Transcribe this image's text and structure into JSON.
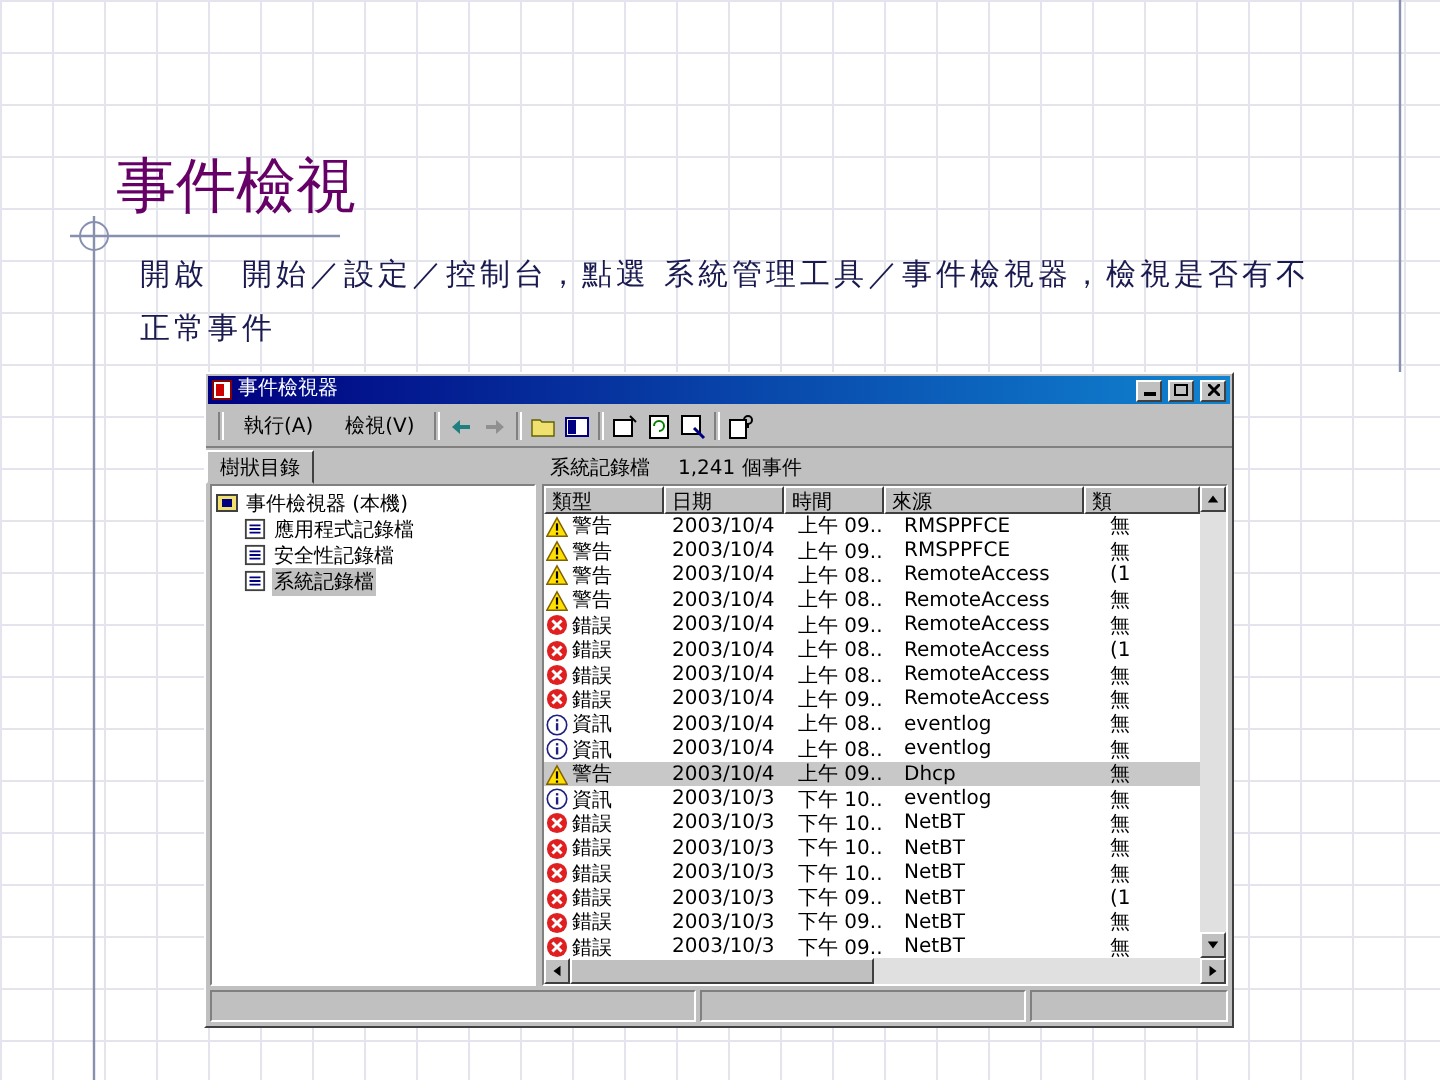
{
  "slide": {
    "title": "事件檢視",
    "body": "開啟　開始／設定／控制台，點選 系統管理工具／事件檢視器，檢視是否有不正常事件"
  },
  "window": {
    "title": "事件檢視器"
  },
  "menu": [
    "執行(A)",
    "檢視(V)"
  ],
  "tree_tab": "樹狀目錄",
  "list_header": {
    "name": "系統記錄檔",
    "count": "1,241 個事件"
  },
  "tree": {
    "label": "事件檢視器 (本機)",
    "children": [
      {
        "label": "應用程式記錄檔",
        "selected": false
      },
      {
        "label": "安全性記錄檔",
        "selected": false
      },
      {
        "label": "系統記錄檔",
        "selected": true
      }
    ]
  },
  "table": {
    "columns": [
      "類型",
      "日期",
      "時間",
      "來源",
      "類"
    ],
    "rows": [
      {
        "kind": "warning",
        "type": "警告",
        "date": "2003/10/4",
        "time": "上午 09..",
        "source": "RMSPPFCE",
        "category": "無",
        "selected": false
      },
      {
        "kind": "warning",
        "type": "警告",
        "date": "2003/10/4",
        "time": "上午 09..",
        "source": "RMSPPFCE",
        "category": "無",
        "selected": false
      },
      {
        "kind": "warning",
        "type": "警告",
        "date": "2003/10/4",
        "time": "上午 08..",
        "source": "RemoteAccess",
        "category": "(1",
        "selected": false
      },
      {
        "kind": "warning",
        "type": "警告",
        "date": "2003/10/4",
        "time": "上午 08..",
        "source": "RemoteAccess",
        "category": "無",
        "selected": false
      },
      {
        "kind": "error",
        "type": "錯誤",
        "date": "2003/10/4",
        "time": "上午 09..",
        "source": "RemoteAccess",
        "category": "無",
        "selected": false
      },
      {
        "kind": "error",
        "type": "錯誤",
        "date": "2003/10/4",
        "time": "上午 08..",
        "source": "RemoteAccess",
        "category": "(1",
        "selected": false
      },
      {
        "kind": "error",
        "type": "錯誤",
        "date": "2003/10/4",
        "time": "上午 08..",
        "source": "RemoteAccess",
        "category": "無",
        "selected": false
      },
      {
        "kind": "error",
        "type": "錯誤",
        "date": "2003/10/4",
        "time": "上午 09..",
        "source": "RemoteAccess",
        "category": "無",
        "selected": false
      },
      {
        "kind": "info",
        "type": "資訊",
        "date": "2003/10/4",
        "time": "上午 08..",
        "source": "eventlog",
        "category": "無",
        "selected": false
      },
      {
        "kind": "info",
        "type": "資訊",
        "date": "2003/10/4",
        "time": "上午 08..",
        "source": "eventlog",
        "category": "無",
        "selected": false
      },
      {
        "kind": "warning",
        "type": "警告",
        "date": "2003/10/4",
        "time": "上午 09..",
        "source": "Dhcp",
        "category": "無",
        "selected": true
      },
      {
        "kind": "info",
        "type": "資訊",
        "date": "2003/10/3",
        "time": "下午 10..",
        "source": "eventlog",
        "category": "無",
        "selected": false
      },
      {
        "kind": "error",
        "type": "錯誤",
        "date": "2003/10/3",
        "time": "下午 10..",
        "source": "NetBT",
        "category": "無",
        "selected": false
      },
      {
        "kind": "error",
        "type": "錯誤",
        "date": "2003/10/3",
        "time": "下午 10..",
        "source": "NetBT",
        "category": "無",
        "selected": false
      },
      {
        "kind": "error",
        "type": "錯誤",
        "date": "2003/10/3",
        "time": "下午 10..",
        "source": "NetBT",
        "category": "無",
        "selected": false
      },
      {
        "kind": "error",
        "type": "錯誤",
        "date": "2003/10/3",
        "time": "下午 09..",
        "source": "NetBT",
        "category": "(1",
        "selected": false
      },
      {
        "kind": "error",
        "type": "錯誤",
        "date": "2003/10/3",
        "time": "下午 09..",
        "source": "NetBT",
        "category": "無",
        "selected": false
      },
      {
        "kind": "error",
        "type": "錯誤",
        "date": "2003/10/3",
        "time": "下午 09..",
        "source": "NetBT",
        "category": "無",
        "selected": false
      }
    ]
  }
}
